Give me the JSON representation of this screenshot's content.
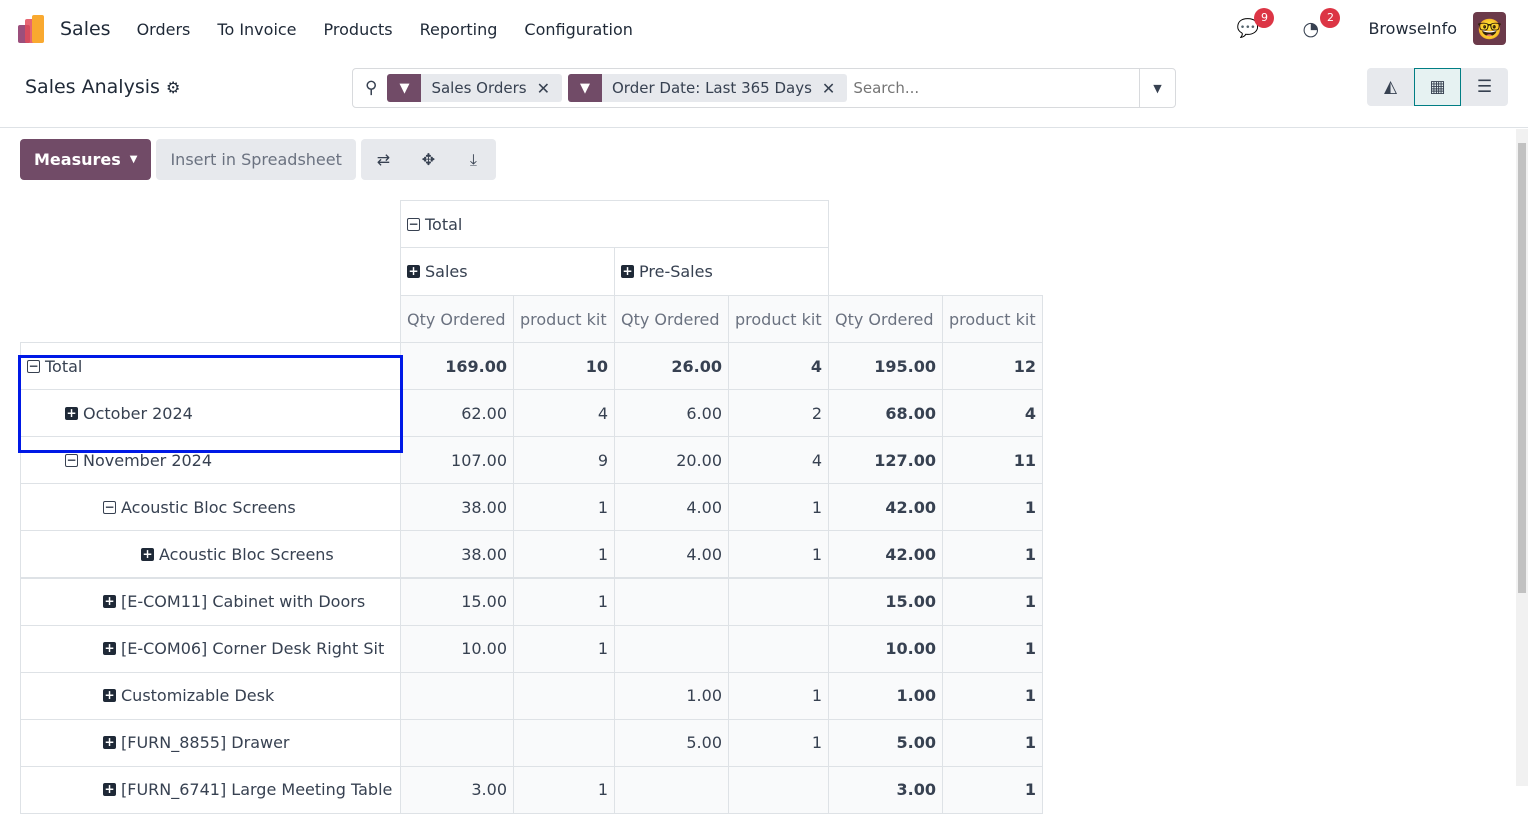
{
  "nav": {
    "app": "Sales",
    "menu": [
      "Orders",
      "To Invoice",
      "Products",
      "Reporting",
      "Configuration"
    ],
    "messages_count": "9",
    "activities_count": "2",
    "user": "BrowseInfo"
  },
  "control": {
    "title": "Sales Analysis",
    "facets": [
      "Sales Orders",
      "Order Date: Last 365 Days"
    ],
    "search_placeholder": "Search..."
  },
  "toolbar": {
    "measures": "Measures",
    "insert": "Insert in Spreadsheet"
  },
  "pivot": {
    "col_total": "Total",
    "col_groups": [
      "Sales",
      "Pre-Sales"
    ],
    "measures": [
      "Qty Ordered",
      "product kit",
      "Qty Ordered",
      "product kit",
      "Qty Ordered",
      "product kit"
    ],
    "rows": [
      {
        "label": "Total",
        "exp": "minus",
        "lvl": 0,
        "v": [
          "169.00",
          "10",
          "26.00",
          "4",
          "195.00",
          "12"
        ]
      },
      {
        "label": "October 2024",
        "exp": "plus",
        "lvl": 1,
        "v": [
          "62.00",
          "4",
          "6.00",
          "2",
          "68.00",
          "4"
        ]
      },
      {
        "label": "November 2024",
        "exp": "minus",
        "lvl": 1,
        "v": [
          "107.00",
          "9",
          "20.00",
          "4",
          "127.00",
          "11"
        ]
      },
      {
        "label": "Acoustic Bloc Screens",
        "exp": "minus",
        "lvl": 2,
        "v": [
          "38.00",
          "1",
          "4.00",
          "1",
          "42.00",
          "1"
        ]
      },
      {
        "label": "Acoustic Bloc Screens",
        "exp": "plus",
        "lvl": 3,
        "v": [
          "38.00",
          "1",
          "4.00",
          "1",
          "42.00",
          "1"
        ]
      },
      {
        "label": "[E-COM11] Cabinet with Doors",
        "exp": "plus",
        "lvl": 2,
        "v": [
          "15.00",
          "1",
          "",
          "",
          "15.00",
          "1"
        ]
      },
      {
        "label": "[E-COM06] Corner Desk Right Sit",
        "exp": "plus",
        "lvl": 2,
        "v": [
          "10.00",
          "1",
          "",
          "",
          "10.00",
          "1"
        ]
      },
      {
        "label": "Customizable Desk",
        "exp": "plus",
        "lvl": 2,
        "v": [
          "",
          "",
          "1.00",
          "1",
          "1.00",
          "1"
        ]
      },
      {
        "label": "[FURN_8855] Drawer",
        "exp": "plus",
        "lvl": 2,
        "v": [
          "",
          "",
          "5.00",
          "1",
          "5.00",
          "1"
        ]
      },
      {
        "label": "[FURN_6741] Large Meeting Table",
        "exp": "plus",
        "lvl": 2,
        "v": [
          "3.00",
          "1",
          "",
          "",
          "3.00",
          "1"
        ]
      }
    ]
  }
}
